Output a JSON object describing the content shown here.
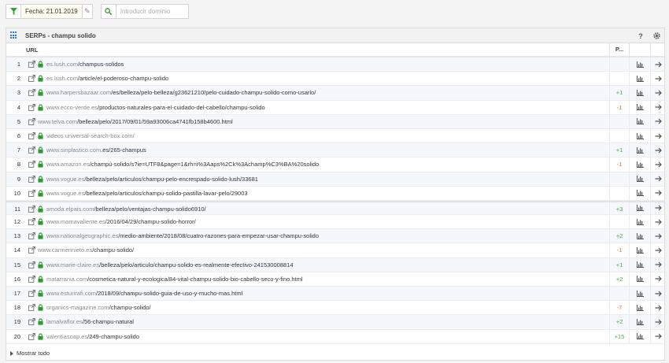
{
  "toolbar": {
    "date_label": "Fecha: 21.01.2019",
    "domain_placeholder": "Introducir dominio"
  },
  "panel": {
    "title": "SERPs - champu solido",
    "help": "?",
    "col_url": "URL",
    "col_pos": "P...",
    "show_all": "Mostrar todo"
  },
  "colors": {
    "accent": "#2d7bd0",
    "lock": "#2f9a2f",
    "up": "#4cae4c",
    "down": "#e0782c"
  },
  "rows": [
    {
      "n": "1",
      "secure": true,
      "domain": "es.lush.com",
      "path": "/champus-solidos",
      "change": ""
    },
    {
      "n": "2",
      "secure": true,
      "domain": "es.lush.com",
      "path": "/article/el-poderoso-champu-solido",
      "change": ""
    },
    {
      "n": "3",
      "secure": true,
      "domain": "www.harpersbazaar.com",
      "path": "/es/belleza/pelo-belleza/g23621210/pelo-cuidado-champu-solido-como-usarlo/",
      "change": "+1"
    },
    {
      "n": "4",
      "secure": true,
      "domain": "www.ecco-verde.es",
      "path": "/productos-naturales-para-el-cuidado-del-cabello/champu-solido",
      "change": "-1"
    },
    {
      "n": "5",
      "secure": false,
      "domain": "www.telva.com",
      "path": "/belleza/pelo/2017/09/01/59a93006ca4741fb158b4600.html",
      "change": ""
    },
    {
      "n": "6",
      "secure": true,
      "domain": "videos.universal-search-box.com/",
      "path": "",
      "change": ""
    },
    {
      "n": "7",
      "secure": true,
      "domain": "www.sinplastico.com",
      "path": ".es/265-champus",
      "change": "+1"
    },
    {
      "n": "8",
      "secure": true,
      "domain": "www.amazon.es",
      "path": "/champú-solido/s?ie=UTF8&page=1&rh=i%3Aaps%2Ck%3Achamp%C3%BA%20solido",
      "change": "-1"
    },
    {
      "n": "9",
      "secure": true,
      "domain": "www.vogue.es",
      "path": "/belleza/pelo/articulos/champu-pelo-encrespado-solido-lush/33681",
      "change": ""
    },
    {
      "n": "10",
      "secure": true,
      "domain": "www.vogue.es",
      "path": "/belleza/pelo/articulos/champu-solido-pastilla-lavar-pelo/29003",
      "change": ""
    },
    {
      "n": "11",
      "secure": true,
      "domain": "smoda.elpais.com",
      "path": "/belleza/pelo/ventajas-champu-solido6910/",
      "change": "+3"
    },
    {
      "n": "12",
      "secure": true,
      "domain": "www.mamavaliente.es",
      "path": "/2016/04/29/champu-solido-horror/",
      "change": ""
    },
    {
      "n": "13",
      "secure": true,
      "domain": "www.nationalgeographic.es",
      "path": "/medio-ambiente/2018/08/cuatro-razones-para-empezar-usar-champu-solido",
      "change": "+2"
    },
    {
      "n": "14",
      "secure": false,
      "domain": "www.carmennieto.es",
      "path": "/champu-solido/",
      "change": "-1"
    },
    {
      "n": "15",
      "secure": true,
      "domain": "www.marie-claire.es",
      "path": "/belleza/pelo/articulo/champu-solido-es-realmente-efectivo-241530008814",
      "change": "+1"
    },
    {
      "n": "16",
      "secure": true,
      "domain": "matarrania.com",
      "path": "/cosmetica-natural-y-ecologica/84-vital-champu-solido-bio-cabello-seco-y-fino.html",
      "change": "+2"
    },
    {
      "n": "17",
      "secure": true,
      "domain": "www.esturirafi.com",
      "path": "/2018/09/champu-solido-guia-de-uso-y-mucho-mas.html",
      "change": ""
    },
    {
      "n": "18",
      "secure": true,
      "domain": "organics-magazine.com",
      "path": "/champu-solido/",
      "change": "-7"
    },
    {
      "n": "19",
      "secure": true,
      "domain": "lamalvaflor.es",
      "path": "/56-champu-natural",
      "change": "+2"
    },
    {
      "n": "20",
      "secure": true,
      "domain": "valentiasoap.es",
      "path": "/249-champu-solido",
      "change": "+15"
    }
  ]
}
